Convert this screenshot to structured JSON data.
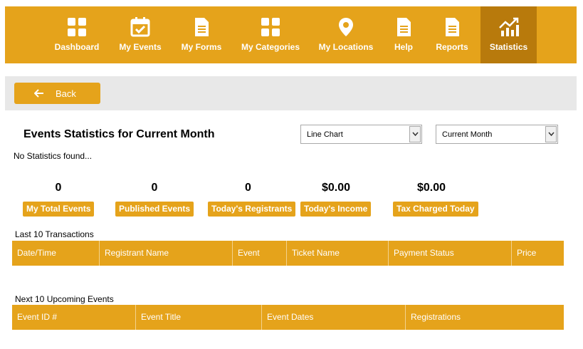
{
  "nav": {
    "items": [
      {
        "label": "Dashboard",
        "icon": "dashboard-grid-icon"
      },
      {
        "label": "My Events",
        "icon": "calendar-check-icon"
      },
      {
        "label": "My Forms",
        "icon": "document-icon"
      },
      {
        "label": "My Categories",
        "icon": "categories-grid-icon"
      },
      {
        "label": "My Locations",
        "icon": "map-pin-icon"
      },
      {
        "label": "Help",
        "icon": "document-icon"
      },
      {
        "label": "Reports",
        "icon": "document-icon"
      },
      {
        "label": "Statistics",
        "icon": "chart-trend-icon"
      }
    ],
    "active": "Statistics"
  },
  "back_button": {
    "label": "Back"
  },
  "page": {
    "title": "Events Statistics for Current Month",
    "no_stats": "No Statistics found..."
  },
  "selects": {
    "chart_type": "Line Chart",
    "period": "Current Month"
  },
  "stats": [
    {
      "value": "0",
      "label": "My Total Events"
    },
    {
      "value": "0",
      "label": "Published Events"
    },
    {
      "value": "0",
      "label": "Today's Registrants"
    },
    {
      "value": "$0.00",
      "label": "Today's Income"
    },
    {
      "value": "$0.00",
      "label": "Tax Charged Today"
    }
  ],
  "transactions": {
    "label": "Last 10 Transactions",
    "columns": [
      "Date/Time",
      "Registrant Name",
      "Event",
      "Ticket Name",
      "Payment Status",
      "Price"
    ]
  },
  "upcoming": {
    "label": "Next 10 Upcoming Events",
    "columns": [
      "Event ID #",
      "Event Title",
      "Event Dates",
      "Registrations"
    ]
  },
  "colors": {
    "accent": "#e5a31b",
    "accent_active": "#b87a0c",
    "bar_gray": "#e8e8e8"
  }
}
